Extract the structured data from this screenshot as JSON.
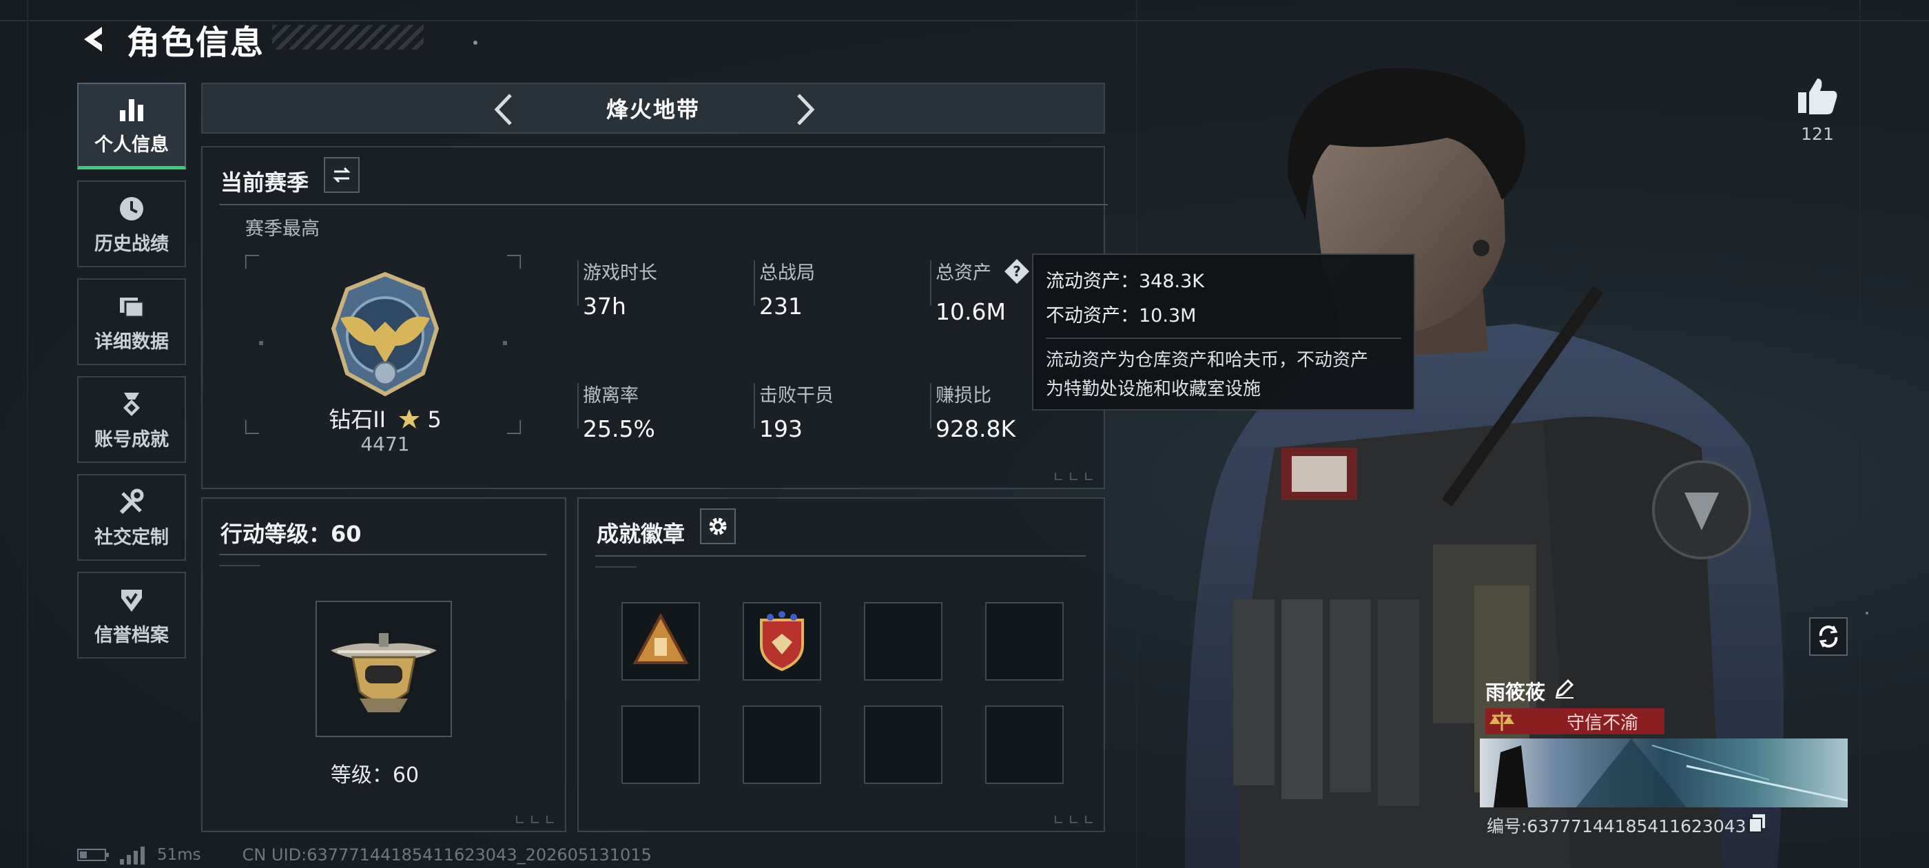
{
  "header": {
    "title": "角色信息"
  },
  "nav": {
    "items": [
      {
        "label": "个人信息",
        "icon": "bar-chart-icon",
        "active": true
      },
      {
        "label": "历史战绩",
        "icon": "clock-icon"
      },
      {
        "label": "详细数据",
        "icon": "folder-icon"
      },
      {
        "label": "账号成就",
        "icon": "medal-icon"
      },
      {
        "label": "社交定制",
        "icon": "wrench-icon"
      },
      {
        "label": "信誉档案",
        "icon": "shield-check-icon"
      }
    ]
  },
  "mode": {
    "name": "烽火地带"
  },
  "season": {
    "title": "当前赛季",
    "subtitle": "赛季最高",
    "rank_name": "钻石II",
    "rank_stars": "5",
    "rank_score": "4471",
    "stats": [
      {
        "label": "游戏时长",
        "value": "37h"
      },
      {
        "label": "总战局",
        "value": "231"
      },
      {
        "label": "总资产",
        "value": "10.6M"
      },
      {
        "label": "撤离率",
        "value": "25.5%"
      },
      {
        "label": "击败干员",
        "value": "193"
      },
      {
        "label": "赚损比",
        "value": "928.8K"
      }
    ]
  },
  "tooltip": {
    "line1": "流动资产：348.3K",
    "line2": "不动资产：10.3M",
    "desc_line1": "流动资产为仓库资产和哈夫币，不动资产",
    "desc_line2": "为特勤处设施和收藏室设施"
  },
  "action_level": {
    "title": "行动等级：60",
    "level_text": "等级：60"
  },
  "achievements": {
    "title": "成就徽章",
    "slots": [
      {
        "icon": "triangle-badge-icon"
      },
      {
        "icon": "shield-badge-icon"
      },
      {},
      {},
      {},
      {},
      {},
      {}
    ]
  },
  "profile": {
    "likes": "121",
    "name": "雨筱莜",
    "title_badge": "守信不渝",
    "id_line": "编号:637771441854116230​43"
  },
  "footer": {
    "ping": "51ms",
    "uid": "CN UID:63777144185411623043_202605131015"
  },
  "colors": {
    "accent_green": "#33d17a",
    "badge_red": "#8a1e20",
    "panel_bg": "#1a2026",
    "border": "#3a444d"
  }
}
